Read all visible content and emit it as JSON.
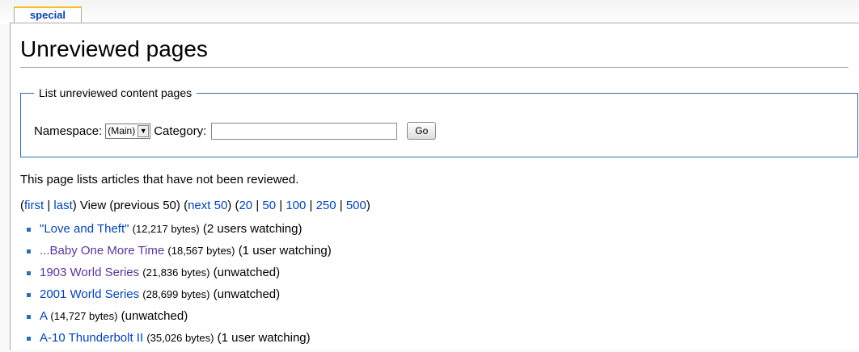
{
  "tab": {
    "label": "special"
  },
  "page_title": "Unreviewed pages",
  "form": {
    "legend": "List unreviewed content pages",
    "namespace_label": "Namespace:",
    "namespace_value": "(Main)",
    "category_label": "Category:",
    "category_value": "",
    "go_label": "Go"
  },
  "intro": "This page lists articles that have not been reviewed.",
  "nav": {
    "first": "first",
    "last": "last",
    "view": "View",
    "previous": "previous 50",
    "next": "next 50",
    "limits": [
      "20",
      "50",
      "100",
      "250",
      "500"
    ]
  },
  "items": [
    {
      "title": "\"Love and Theft\"",
      "bytes": "(12,217 bytes)",
      "status": "(2 users watching)",
      "visited": false
    },
    {
      "title": "...Baby One More Time",
      "bytes": "(18,567 bytes)",
      "status": "(1 user watching)",
      "visited": true
    },
    {
      "title": "1903 World Series",
      "bytes": "(21,836 bytes)",
      "status": "(unwatched)",
      "visited": true
    },
    {
      "title": "2001 World Series",
      "bytes": "(28,699 bytes)",
      "status": "(unwatched)",
      "visited": false
    },
    {
      "title": "A",
      "bytes": "(14,727 bytes)",
      "status": "(unwatched)",
      "visited": false
    },
    {
      "title": "A-10 Thunderbolt II",
      "bytes": "(35,026 bytes)",
      "status": "(1 user watching)",
      "visited": false
    }
  ],
  "colors": {
    "link": "#0645ad",
    "visited": "#5a3696",
    "tab_accent": "#fabd23",
    "border": "#2f6fab"
  }
}
